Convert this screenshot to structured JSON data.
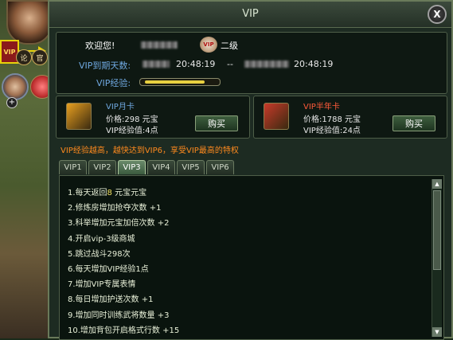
{
  "left": {
    "vip_badge": "VIP",
    "btn_lun": "论",
    "btn_guan": "官",
    "plus": "+"
  },
  "window": {
    "title": "VIP",
    "close": "X"
  },
  "info": {
    "welcome": "欢迎您!",
    "vip_coin": "VIP",
    "level": "二级",
    "expiry_label": "VIP到期天数:",
    "start_time": "20:48:19",
    "separator": "--",
    "end_time": "20:48:19",
    "exp_label": "VIP经验:",
    "exp_progress": 0.85
  },
  "cards": [
    {
      "name": "VIP月卡",
      "name_color": "#6fa8e0",
      "price_label": "价格:",
      "price": "298",
      "currency": "元宝",
      "exp_label": "VIP经验值:",
      "exp": "4点",
      "buy": "购买",
      "icon_color": "#e8a020"
    },
    {
      "name": "VIP半年卡",
      "name_color": "#ff5a3a",
      "price_label": "价格:",
      "price": "1788",
      "currency": "元宝",
      "exp_label": "VIP经验值:",
      "exp": "24点",
      "buy": "购买",
      "icon_color": "#c83a2a"
    }
  ],
  "hint": "VIP经验越高，越快达到VIP6，享受VIP最高的特权",
  "tabs": [
    "VIP1",
    "VIP2",
    "VIP3",
    "VIP4",
    "VIP5",
    "VIP6"
  ],
  "active_tab": 2,
  "benefits": [
    {
      "pre": "1.每天返回",
      "hl": "8",
      "post": " 元宝元宝"
    },
    {
      "pre": "2.修炼房增加抢夺次数 +1",
      "hl": "",
      "post": ""
    },
    {
      "pre": "3.科举增加元宝加倍次数 +2",
      "hl": "",
      "post": ""
    },
    {
      "pre": "4.开启vip-3级商城",
      "hl": "",
      "post": ""
    },
    {
      "pre": "5.跳过战斗298次",
      "hl": "",
      "post": ""
    },
    {
      "pre": "6.每天增加VIP经验1点",
      "hl": "",
      "post": ""
    },
    {
      "pre": "7.增加VIP专属表情",
      "hl": "",
      "post": ""
    },
    {
      "pre": "8.每日增加护送次数 +1",
      "hl": "",
      "post": ""
    },
    {
      "pre": "9.增加同时训练武将数量 +3",
      "hl": "",
      "post": ""
    },
    {
      "pre": "10.增加背包开启格式行数 +15",
      "hl": "",
      "post": ""
    }
  ],
  "colors": {
    "accent_gold": "#e8d20a",
    "hint_orange": "#ff8a1e",
    "label_blue": "#6fa8e0"
  }
}
